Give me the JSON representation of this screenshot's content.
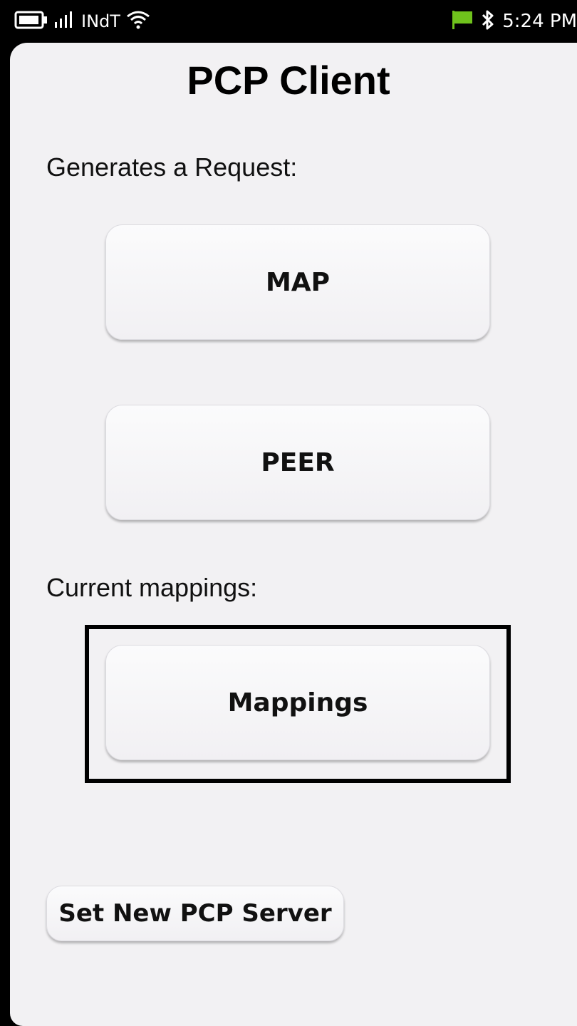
{
  "statusbar": {
    "carrier": "INdT",
    "time": "5:24 PM",
    "icons": [
      "battery-icon",
      "signal-icon",
      "wifi-icon",
      "flag-icon",
      "bluetooth-icon"
    ],
    "flag_color": "#6fc21c"
  },
  "app": {
    "title": "PCP Client"
  },
  "request_section": {
    "label": "Generates a Request:",
    "map_button": "MAP",
    "peer_button": "PEER"
  },
  "mappings_section": {
    "label": "Current mappings:",
    "mappings_button": "Mappings"
  },
  "footer": {
    "set_server_button": "Set New PCP Server"
  }
}
